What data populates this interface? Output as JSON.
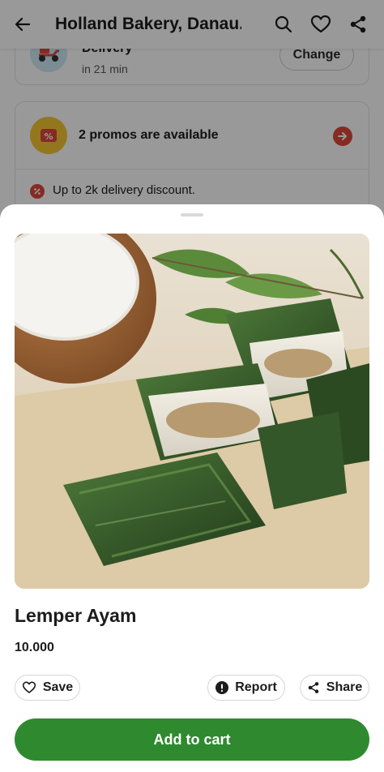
{
  "header": {
    "title": "Holland Bakery, Danau...",
    "icons": [
      "back-arrow-icon",
      "search-icon",
      "heart-icon",
      "share-icon"
    ]
  },
  "delivery": {
    "title": "Delivery",
    "eta": "in 21 min",
    "change_label": "Change"
  },
  "promo": {
    "title": "2 promos are available",
    "discount": "Up to 2k delivery discount."
  },
  "product": {
    "name": "Lemper Ayam",
    "price": "10.000",
    "save_label": "Save",
    "report_label": "Report",
    "share_label": "Share",
    "add_to_cart_label": "Add to cart"
  },
  "colors": {
    "accent_green": "#2f8a2f",
    "promo_red": "#e0463c",
    "promo_yellow": "#f6c635"
  }
}
